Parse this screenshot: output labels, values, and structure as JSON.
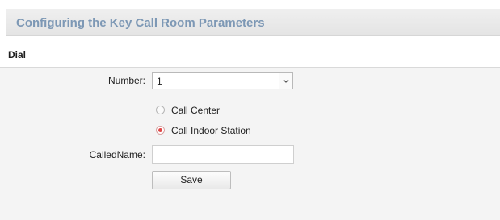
{
  "header": {
    "title": "Configuring the Key Call Room Parameters"
  },
  "section": {
    "title": "Dial"
  },
  "form": {
    "number": {
      "label": "Number:",
      "value": "1",
      "icon": "chevron-down-icon"
    },
    "call_options": [
      {
        "label": "Call Center",
        "checked": false
      },
      {
        "label": "Call Indoor Station",
        "checked": true
      }
    ],
    "called_name": {
      "label": "CalledName:",
      "value": ""
    },
    "save_label": "Save"
  },
  "colors": {
    "title_text": "#7d98b5",
    "radio_selected": "#e04848",
    "panel_bg": "#f4f4f4"
  }
}
